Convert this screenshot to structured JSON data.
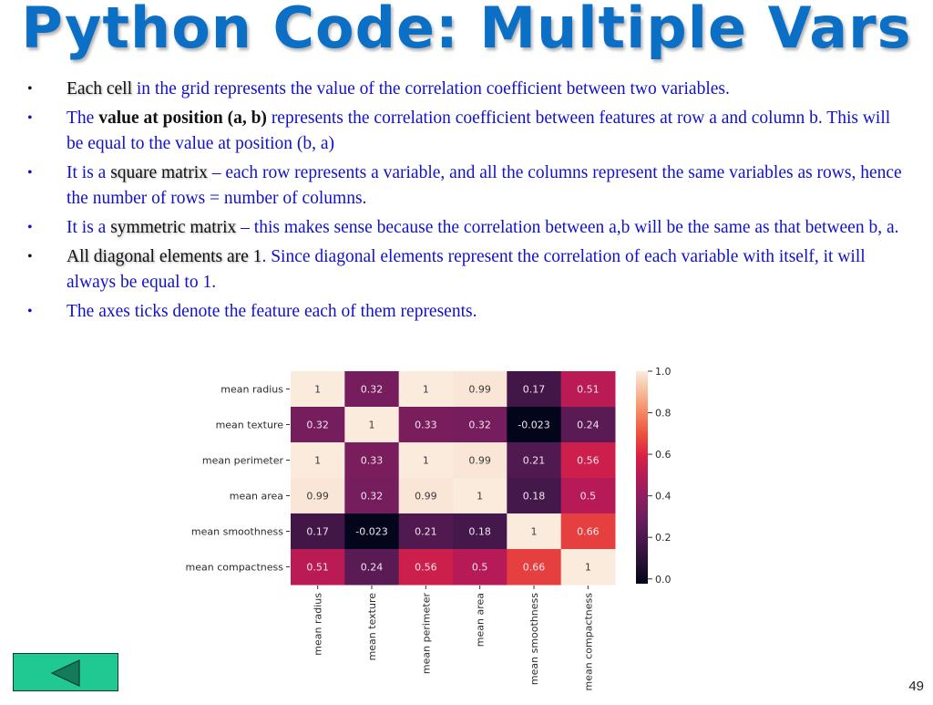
{
  "slide": {
    "title": "Python Code: Multiple Vars",
    "page_number": "49",
    "nav": {
      "back_label": "previous-slide"
    }
  },
  "bullets": [
    {
      "parts": [
        {
          "text": "Each cell",
          "style": "hl shadow"
        },
        {
          "text": " in the grid represents the value of the correlation coefficient between two variables.",
          "style": ""
        }
      ],
      "dot": "dark"
    },
    {
      "parts": [
        {
          "text": "The ",
          "style": ""
        },
        {
          "text": "value at position (a, b)",
          "style": "hl bold"
        },
        {
          "text": " represents the correlation coefficient between features at row a and column b. This will be equal to the value at position (b, a)",
          "style": ""
        }
      ],
      "dot": ""
    },
    {
      "parts": [
        {
          "text": "It is a ",
          "style": ""
        },
        {
          "text": "square matrix",
          "style": "hl shadow"
        },
        {
          "text": " – each row represents a variable, and all the columns represent the same variables as rows, hence the number of rows = number of columns.",
          "style": ""
        }
      ],
      "dot": ""
    },
    {
      "parts": [
        {
          "text": "It is a ",
          "style": ""
        },
        {
          "text": "symmetric matrix",
          "style": "hl shadow"
        },
        {
          "text": " – this makes sense because the correlation between a,b will be the same as that between b, a.",
          "style": ""
        }
      ],
      "dot": ""
    },
    {
      "parts": [
        {
          "text": "All diagonal elements are 1",
          "style": "hl shadow"
        },
        {
          "text": ". Since diagonal elements represent the correlation of each variable with itself, it will always be equal to 1.",
          "style": ""
        }
      ],
      "dot": "dark"
    },
    {
      "parts": [
        {
          "text": "The axes ticks denote the feature each of them represents.",
          "style": ""
        }
      ],
      "dot": ""
    }
  ],
  "chart_data": {
    "type": "heatmap",
    "title": "",
    "xlabel": "",
    "ylabel": "",
    "row_labels": [
      "mean radius",
      "mean texture",
      "mean perimeter",
      "mean area",
      "mean smoothness",
      "mean compactness"
    ],
    "col_labels": [
      "mean radius",
      "mean texture",
      "mean perimeter",
      "mean area",
      "mean smoothness",
      "mean compactness"
    ],
    "values": [
      [
        1,
        0.32,
        1,
        0.99,
        0.17,
        0.51
      ],
      [
        0.32,
        1,
        0.33,
        0.32,
        -0.023,
        0.24
      ],
      [
        1,
        0.33,
        1,
        0.99,
        0.21,
        0.56
      ],
      [
        0.99,
        0.32,
        0.99,
        1,
        0.18,
        0.5
      ],
      [
        0.17,
        -0.023,
        0.21,
        0.18,
        1,
        0.66
      ],
      [
        0.51,
        0.24,
        0.56,
        0.5,
        0.66,
        1
      ]
    ],
    "value_labels": [
      [
        "1",
        "0.32",
        "1",
        "0.99",
        "0.17",
        "0.51"
      ],
      [
        "0.32",
        "1",
        "0.33",
        "0.32",
        "-0.023",
        "0.24"
      ],
      [
        "1",
        "0.33",
        "1",
        "0.99",
        "0.21",
        "0.56"
      ],
      [
        "0.99",
        "0.32",
        "0.99",
        "1",
        "0.18",
        "0.5"
      ],
      [
        "0.17",
        "-0.023",
        "0.21",
        "0.18",
        "1",
        "0.66"
      ],
      [
        "0.51",
        "0.24",
        "0.56",
        "0.5",
        "0.66",
        "1"
      ]
    ],
    "colormap": "rocket",
    "color_range": [
      -0.023,
      1.0
    ],
    "colorbar": {
      "ticks": [
        0.0,
        0.2,
        0.4,
        0.6,
        0.8,
        1.0
      ],
      "tick_labels": [
        "0.0",
        "0.2",
        "0.4",
        "0.6",
        "0.8",
        "1.0"
      ],
      "placement": "right"
    },
    "annotated": true,
    "grid": false
  },
  "colors": {
    "title": "#0b6fc6",
    "body_text": "#1111cc",
    "highlight_text": "#111111",
    "nav_button": "#1fc991",
    "nav_arrow": "#137a5a"
  }
}
